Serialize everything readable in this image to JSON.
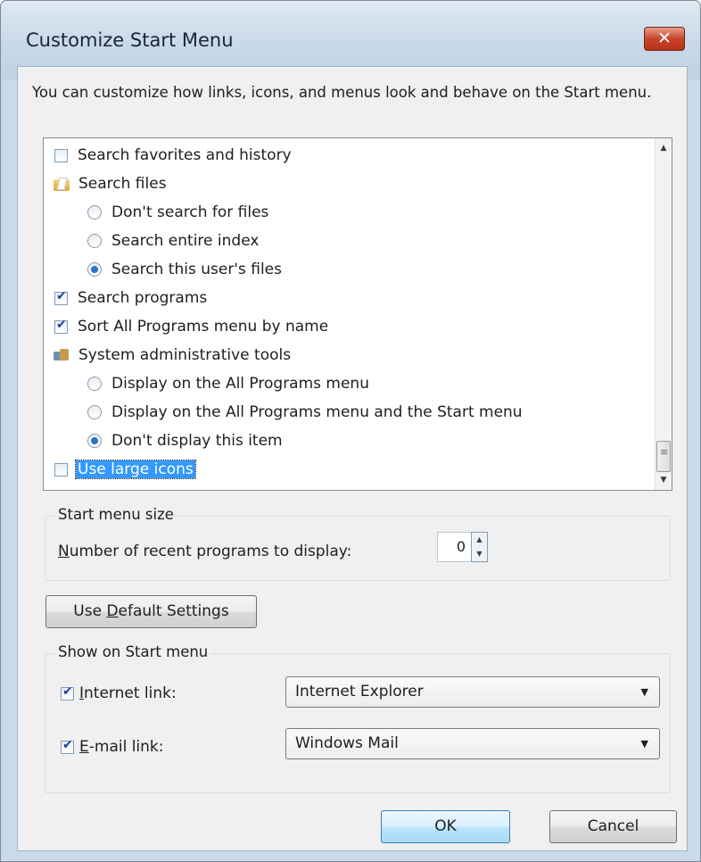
{
  "dialog": {
    "title": "Customize Start Menu",
    "close_label": "✕",
    "intro_text": "You can customize how links, icons, and menus look and behave on the Start menu."
  },
  "options_list": {
    "items": [
      {
        "type": "checkbox",
        "label": "Search favorites and history",
        "checked": false
      },
      {
        "type": "group-icon",
        "icon": "search-files-icon",
        "label": "Search files"
      },
      {
        "type": "radio",
        "label": "Don't search for files",
        "checked": false
      },
      {
        "type": "radio",
        "label": "Search entire index",
        "checked": false
      },
      {
        "type": "radio",
        "label": "Search this user's files",
        "checked": true
      },
      {
        "type": "checkbox",
        "label": "Search programs",
        "checked": true
      },
      {
        "type": "checkbox",
        "label": "Sort All Programs menu by name",
        "checked": true
      },
      {
        "type": "group-icon",
        "icon": "admin-tools-icon",
        "label": "System administrative tools"
      },
      {
        "type": "radio",
        "label": "Display on the All Programs menu",
        "checked": false
      },
      {
        "type": "radio",
        "label": "Display on the All Programs menu and the Start menu",
        "checked": false
      },
      {
        "type": "radio",
        "label": "Don't display this item",
        "checked": true
      },
      {
        "type": "checkbox",
        "label": "Use large icons",
        "checked": false,
        "selected": true
      }
    ]
  },
  "start_menu_size": {
    "group_label": "Start menu size",
    "recent_prefix": "N",
    "recent_rest": "umber of recent programs to display:",
    "recent_value": "0"
  },
  "default_button": {
    "prefix": "Use ",
    "accel": "D",
    "rest": "efault Settings"
  },
  "show_on_start": {
    "group_label": "Show on Start menu",
    "internet": {
      "accel": "I",
      "rest": "nternet link:",
      "checked": true,
      "value": "Internet Explorer"
    },
    "email": {
      "accel": "E",
      "rest": "-mail link:",
      "checked": true,
      "value": "Windows Mail"
    }
  },
  "footer": {
    "ok_label": "OK",
    "cancel_label": "Cancel"
  }
}
